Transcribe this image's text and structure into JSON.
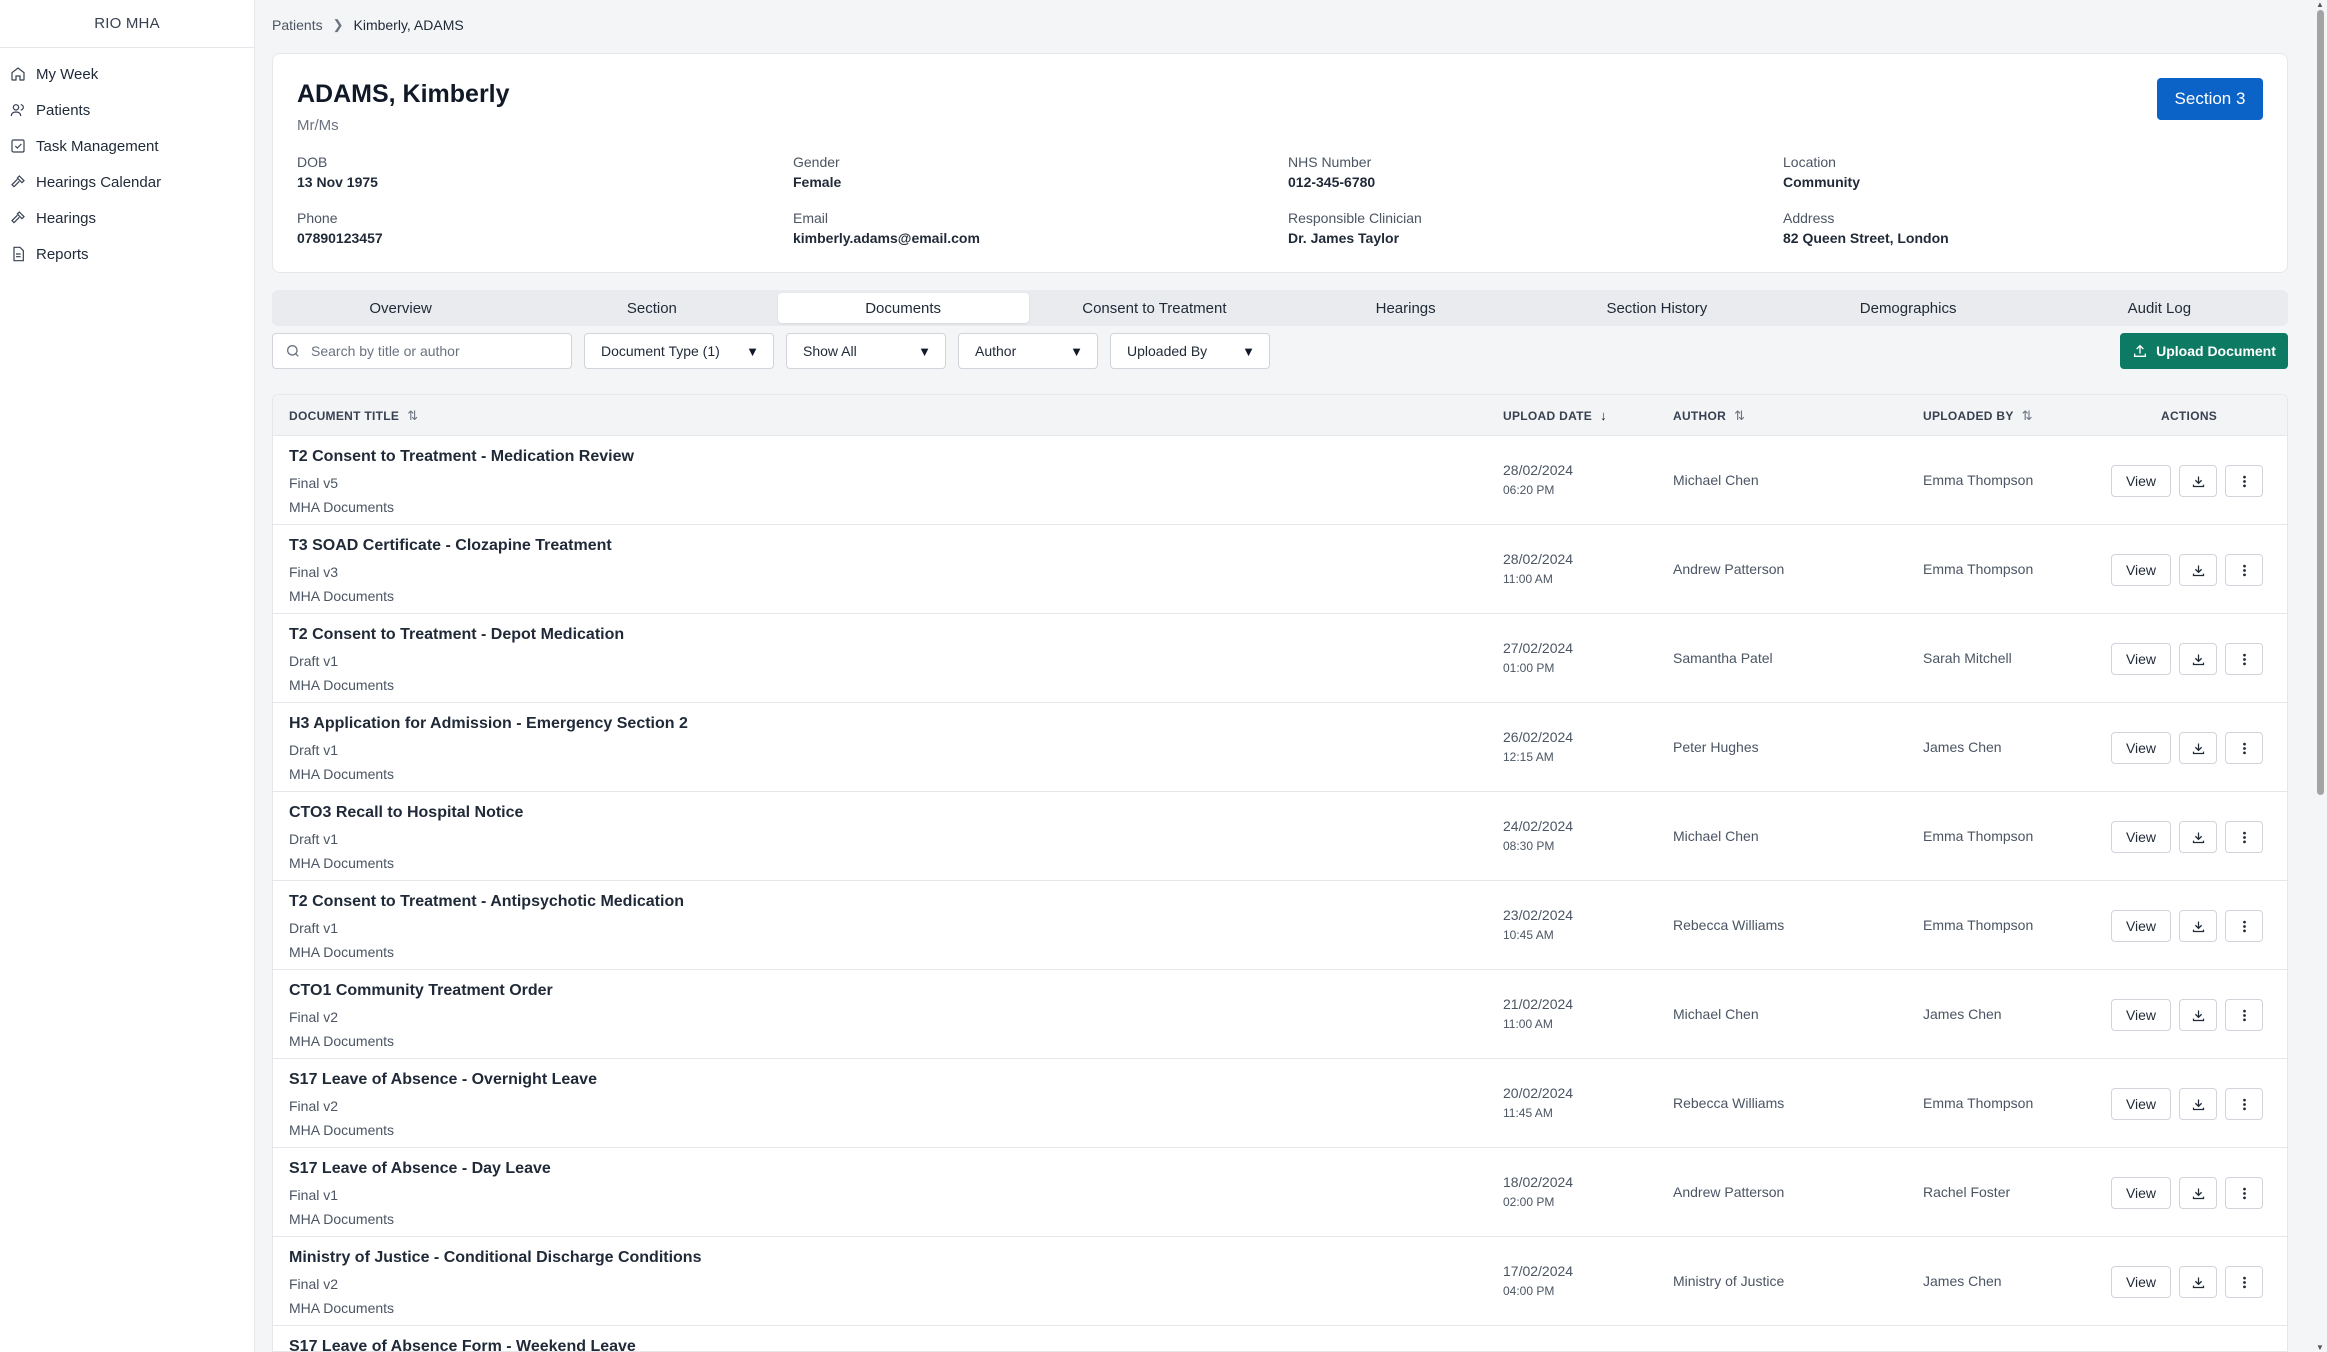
{
  "app": {
    "title": "RIO MHA"
  },
  "sidebar": {
    "items": [
      {
        "label": "My Week",
        "icon": "home-icon"
      },
      {
        "label": "Patients",
        "icon": "users-icon"
      },
      {
        "label": "Task Management",
        "icon": "checkbox-icon"
      },
      {
        "label": "Hearings Calendar",
        "icon": "gavel-icon"
      },
      {
        "label": "Hearings",
        "icon": "gavel-icon"
      },
      {
        "label": "Reports",
        "icon": "document-icon"
      }
    ]
  },
  "breadcrumb": {
    "root": "Patients",
    "current": "Kimberly, ADAMS"
  },
  "patient": {
    "name": "ADAMS, Kimberly",
    "title": "Mr/Ms",
    "section_label": "Section 3",
    "fields": {
      "dob": {
        "label": "DOB",
        "value": "13 Nov 1975"
      },
      "gender": {
        "label": "Gender",
        "value": "Female"
      },
      "nhs": {
        "label": "NHS Number",
        "value": "012-345-6780"
      },
      "location": {
        "label": "Location",
        "value": "Community"
      },
      "phone": {
        "label": "Phone",
        "value": "07890123457"
      },
      "email": {
        "label": "Email",
        "value": "kimberly.adams@email.com"
      },
      "clinician": {
        "label": "Responsible Clinician",
        "value": "Dr. James Taylor"
      },
      "address": {
        "label": "Address",
        "value": "82 Queen Street, London"
      }
    }
  },
  "tabs": [
    {
      "label": "Overview"
    },
    {
      "label": "Section"
    },
    {
      "label": "Documents",
      "active": true
    },
    {
      "label": "Consent to Treatment"
    },
    {
      "label": "Hearings"
    },
    {
      "label": "Section History"
    },
    {
      "label": "Demographics"
    },
    {
      "label": "Audit Log"
    }
  ],
  "toolbar": {
    "search_placeholder": "Search by title or author",
    "search_value": "",
    "filters": {
      "doc_type": "Document Type (1)",
      "show": "Show All",
      "author": "Author",
      "uploaded_by": "Uploaded By"
    },
    "upload_label": "Upload Document"
  },
  "table": {
    "headers": {
      "title": "DOCUMENT TITLE",
      "upload_date": "UPLOAD DATE",
      "author": "AUTHOR",
      "uploaded_by": "UPLOADED BY",
      "actions": "ACTIONS"
    },
    "view_label": "View",
    "rows": [
      {
        "title": "T2 Consent to Treatment - Medication Review",
        "version": "Final v5",
        "category": "MHA Documents",
        "date": "28/02/2024",
        "time": "06:20 PM",
        "author": "Michael Chen",
        "uploaded_by": "Emma Thompson"
      },
      {
        "title": "T3 SOAD Certificate - Clozapine Treatment",
        "version": "Final v3",
        "category": "MHA Documents",
        "date": "28/02/2024",
        "time": "11:00 AM",
        "author": "Andrew Patterson",
        "uploaded_by": "Emma Thompson"
      },
      {
        "title": "T2 Consent to Treatment - Depot Medication",
        "version": "Draft v1",
        "category": "MHA Documents",
        "date": "27/02/2024",
        "time": "01:00 PM",
        "author": "Samantha Patel",
        "uploaded_by": "Sarah Mitchell"
      },
      {
        "title": "H3 Application for Admission - Emergency Section 2",
        "version": "Draft v1",
        "category": "MHA Documents",
        "date": "26/02/2024",
        "time": "12:15 AM",
        "author": "Peter Hughes",
        "uploaded_by": "James Chen"
      },
      {
        "title": "CTO3 Recall to Hospital Notice",
        "version": "Draft v1",
        "category": "MHA Documents",
        "date": "24/02/2024",
        "time": "08:30 PM",
        "author": "Michael Chen",
        "uploaded_by": "Emma Thompson"
      },
      {
        "title": "T2 Consent to Treatment - Antipsychotic Medication",
        "version": "Draft v1",
        "category": "MHA Documents",
        "date": "23/02/2024",
        "time": "10:45 AM",
        "author": "Rebecca Williams",
        "uploaded_by": "Emma Thompson"
      },
      {
        "title": "CTO1 Community Treatment Order",
        "version": "Final v2",
        "category": "MHA Documents",
        "date": "21/02/2024",
        "time": "11:00 AM",
        "author": "Michael Chen",
        "uploaded_by": "James Chen"
      },
      {
        "title": "S17 Leave of Absence - Overnight Leave",
        "version": "Final v2",
        "category": "MHA Documents",
        "date": "20/02/2024",
        "time": "11:45 AM",
        "author": "Rebecca Williams",
        "uploaded_by": "Emma Thompson"
      },
      {
        "title": "S17 Leave of Absence - Day Leave",
        "version": "Final v1",
        "category": "MHA Documents",
        "date": "18/02/2024",
        "time": "02:00 PM",
        "author": "Andrew Patterson",
        "uploaded_by": "Rachel Foster"
      },
      {
        "title": "Ministry of Justice - Conditional Discharge Conditions",
        "version": "Final v2",
        "category": "MHA Documents",
        "date": "17/02/2024",
        "time": "04:00 PM",
        "author": "Ministry of Justice",
        "uploaded_by": "James Chen"
      },
      {
        "title": "S17 Leave of Absence Form - Weekend Leave",
        "version": "",
        "category": "",
        "date": "",
        "time": "",
        "author": "",
        "uploaded_by": ""
      }
    ]
  },
  "colors": {
    "primary": "#0b63c7",
    "success": "#0d7a63"
  }
}
